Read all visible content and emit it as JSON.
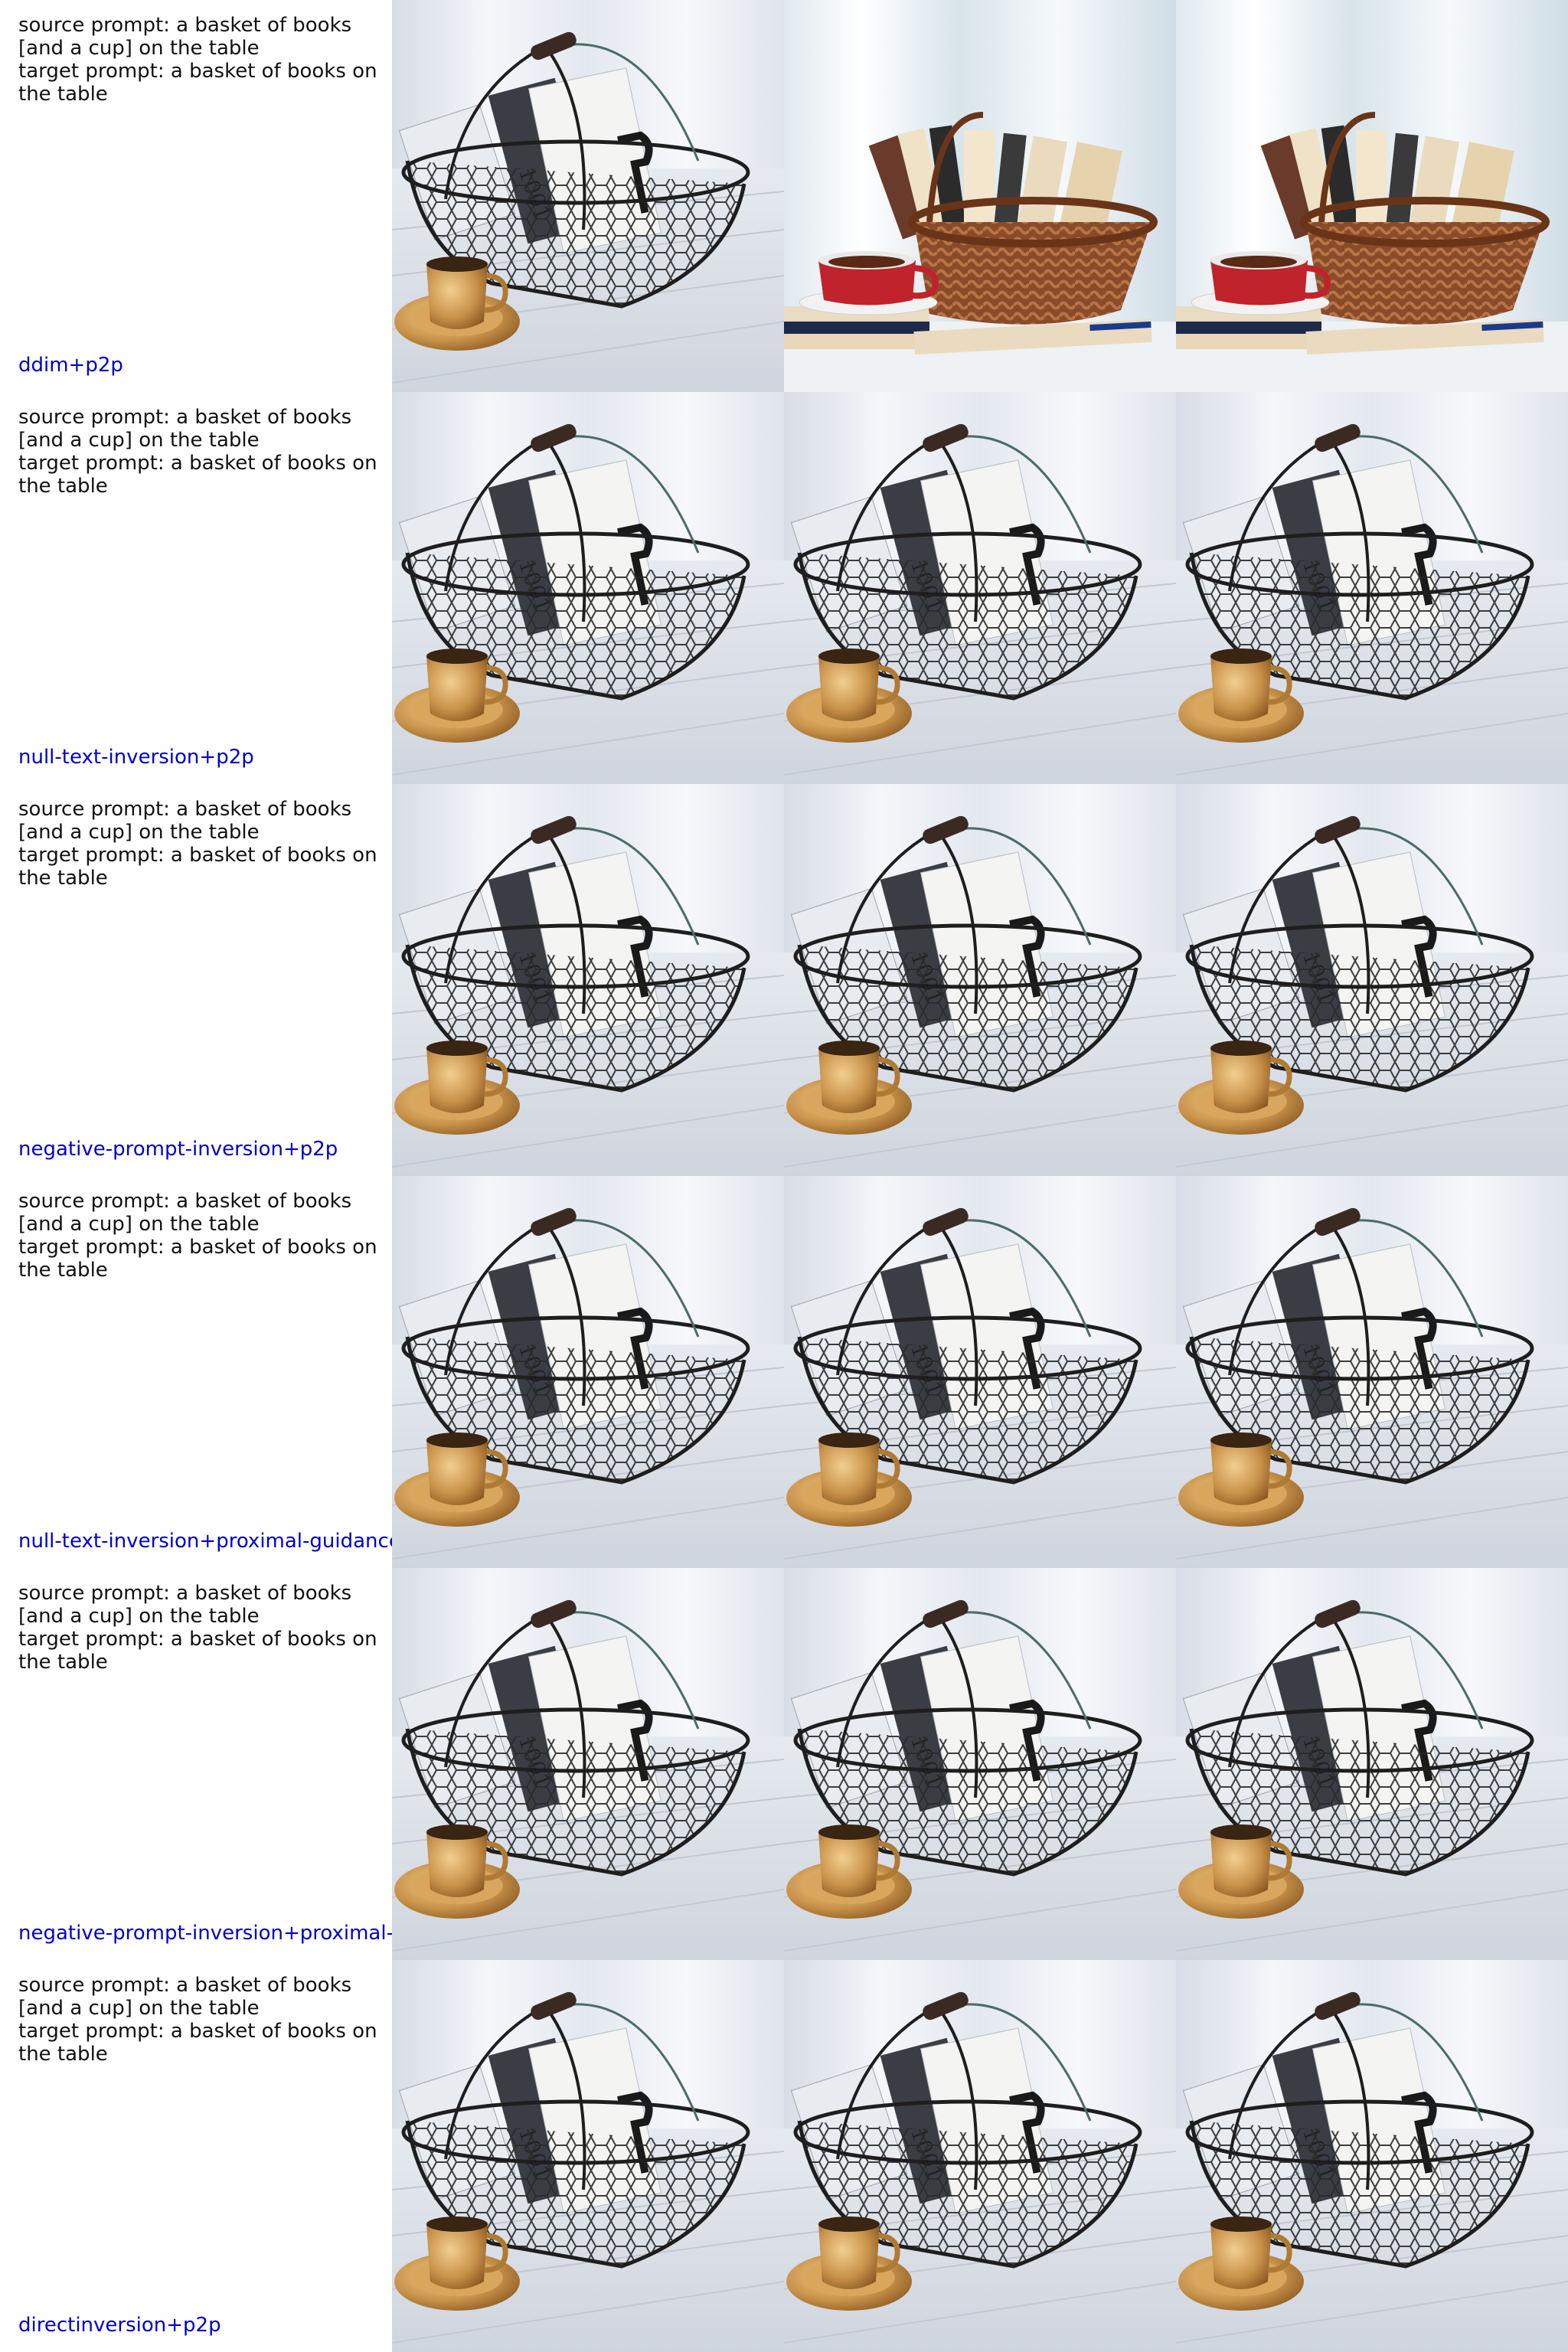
{
  "rows": [
    {
      "source_prompt": "source prompt: a basket of books [and a cup] on the table",
      "target_prompt": "target prompt: a basket of books on the table",
      "method": "ddim+p2p",
      "images": [
        {
          "kind": "wire",
          "description": "wire basket of books with gold cup"
        },
        {
          "kind": "wicker",
          "description": "wicker basket of books with red cup"
        },
        {
          "kind": "wicker",
          "description": "wicker basket of books with red cup"
        }
      ]
    },
    {
      "source_prompt": "source prompt: a basket of books [and a cup] on the table",
      "target_prompt": "target prompt: a basket of books on the table",
      "method": "null-text-inversion+p2p",
      "images": [
        {
          "kind": "wire",
          "description": "wire basket of books with gold cup"
        },
        {
          "kind": "wire",
          "description": "wire basket of books with gold cup"
        },
        {
          "kind": "wire",
          "description": "wire basket of books with faded cup"
        }
      ]
    },
    {
      "source_prompt": "source prompt: a basket of books [and a cup] on the table",
      "target_prompt": "target prompt: a basket of books on the table",
      "method": "negative-prompt-inversion+p2p",
      "images": [
        {
          "kind": "wire",
          "description": "wire basket of books with gold cup"
        },
        {
          "kind": "wire",
          "description": "wire basket of books with gold cup"
        },
        {
          "kind": "wire",
          "description": "wire basket of books with distorted cup"
        }
      ]
    },
    {
      "source_prompt": "source prompt: a basket of books [and a cup] on the table",
      "target_prompt": "target prompt: a basket of books on the table",
      "method": "null-text-inversion+proximal-guidance",
      "images": [
        {
          "kind": "wire",
          "description": "wire basket of books with gold cup"
        },
        {
          "kind": "wire",
          "description": "wire basket of books with gold cup"
        },
        {
          "kind": "wire",
          "description": "wire basket of books with gold cup"
        }
      ]
    },
    {
      "source_prompt": "source prompt: a basket of books [and a cup] on the table",
      "target_prompt": "target prompt: a basket of books on the table",
      "method": "negative-prompt-inversion+proximal-g",
      "images": [
        {
          "kind": "wire",
          "description": "wire basket of books with gold cup"
        },
        {
          "kind": "wire",
          "description": "wire basket of books with gold cup"
        },
        {
          "kind": "wire",
          "description": "wire basket of books with distorted cup"
        }
      ]
    },
    {
      "source_prompt": "source prompt: a basket of books [and a cup] on the table",
      "target_prompt": "target prompt: a basket of books on the table",
      "method": "directinversion+p2p",
      "images": [
        {
          "kind": "wire",
          "description": "wire basket of books with gold cup"
        },
        {
          "kind": "wire",
          "description": "wire basket of books with gold cup"
        },
        {
          "kind": "wire",
          "description": "wire basket of books with gold cup"
        }
      ]
    }
  ],
  "colors": {
    "label_text": "#111111",
    "method_text": "#0000cc",
    "background": "#ffffff",
    "wood": "#dfe3ea",
    "wire": "#2a2a2a",
    "gold": "#c9924a",
    "wicker": "#8a4b2a",
    "red_cup": "#c0232b"
  }
}
